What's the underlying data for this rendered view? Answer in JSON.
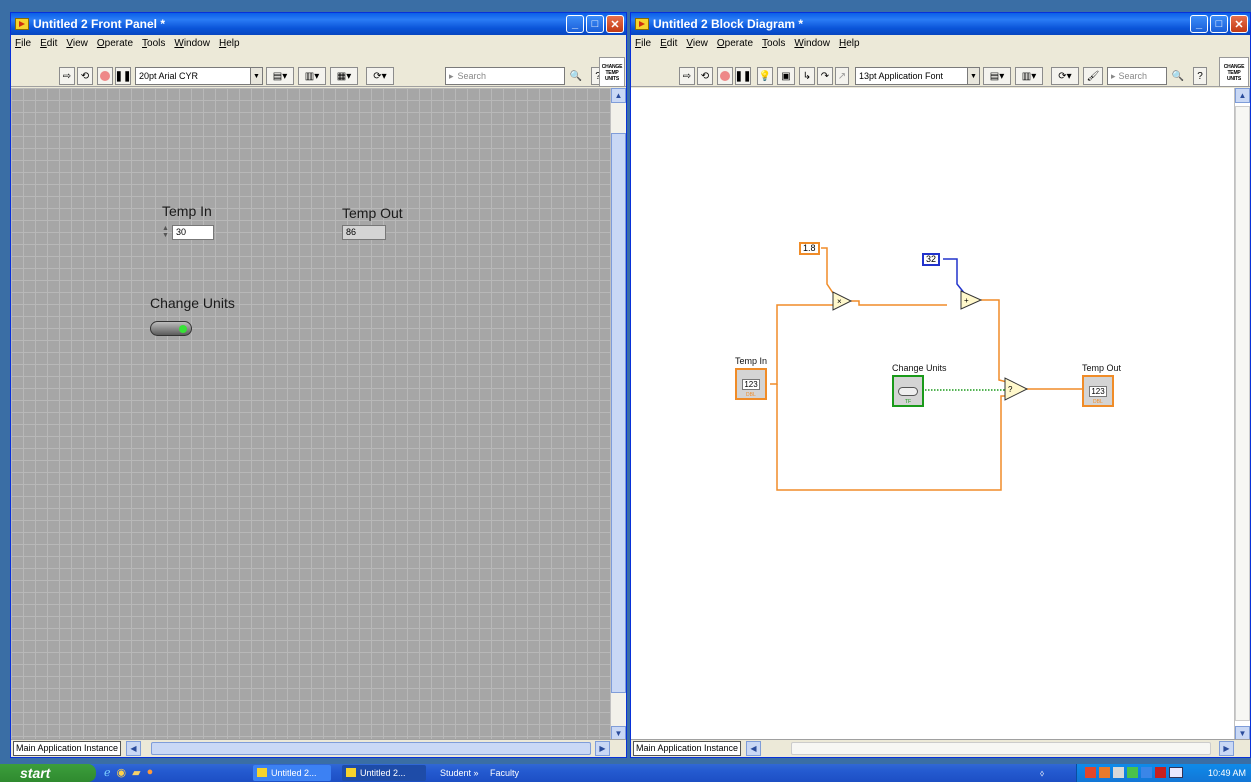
{
  "front_panel": {
    "title": "Untitled 2 Front Panel *",
    "menu": [
      "File",
      "Edit",
      "View",
      "Operate",
      "Tools",
      "Window",
      "Help"
    ],
    "font_select": "20pt Arial CYR",
    "search_placeholder": "Search",
    "icon_text": "CHANGE TEMP UNITS",
    "temp_in_label": "Temp In",
    "temp_in_value": "30",
    "temp_out_label": "Temp Out",
    "temp_out_value": "86",
    "change_units_label": "Change Units",
    "instance": "Main Application Instance"
  },
  "block_diagram": {
    "title": "Untitled 2 Block Diagram *",
    "menu": [
      "File",
      "Edit",
      "View",
      "Operate",
      "Tools",
      "Window",
      "Help"
    ],
    "font_select": "13pt Application Font",
    "search_placeholder": "Search",
    "icon_text": "CHANGE TEMP UNITS",
    "const_a": "1.8",
    "const_b": "32",
    "temp_in_label": "Temp In",
    "temp_out_label": "Temp Out",
    "change_units_label": "Change Units",
    "term_num": "123",
    "term_dbl": "DBL",
    "term_tf": "TF",
    "instance": "Main Application Instance"
  },
  "taskbar": {
    "start": "start",
    "tasks": [
      "Untitled 2...",
      "Untitled 2..."
    ],
    "toolbar1": "Student",
    "toolbar2": "Faculty",
    "clock": "10:49 AM"
  }
}
